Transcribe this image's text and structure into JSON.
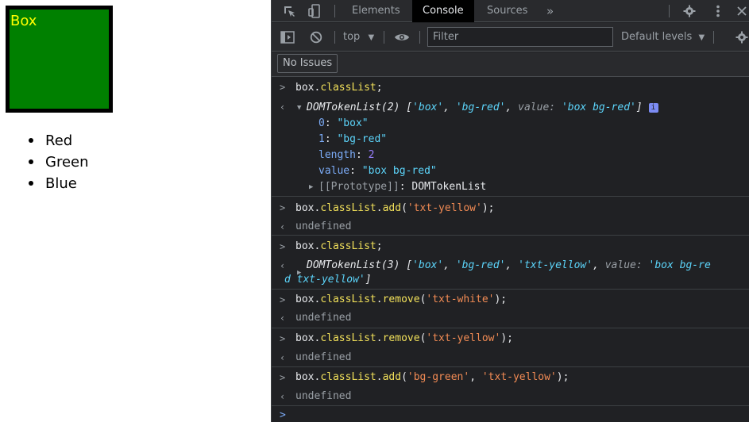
{
  "page": {
    "box_text": "Box",
    "list_items": [
      "Red",
      "Green",
      "Blue"
    ],
    "colors": {
      "box_bg": "#008000",
      "box_text": "#ffff00",
      "box_border": "#000000"
    }
  },
  "devtools": {
    "tabs": [
      "Elements",
      "Console",
      "Sources"
    ],
    "active_tab": "Console",
    "more_tabs_glyph": "»",
    "context": "top",
    "filter_placeholder": "Filter",
    "levels": "Default levels",
    "issues_button": "No Issues",
    "icons": [
      "inspect-icon",
      "device-toggle-icon",
      "gear-icon",
      "more-vert-icon",
      "sidebar-toggle-icon",
      "clear-console-icon",
      "eye-icon",
      "settings-icon"
    ]
  },
  "console": {
    "cmd1": {
      "obj": "box",
      "prop": "classList",
      "end": ";"
    },
    "out1": {
      "type": "DOMTokenList(2)",
      "summary_open": "[",
      "s1": "'box'",
      "s2": "'bg-red'",
      "value_key": "value:",
      "value_str": "'box bg-red'",
      "summary_close": "]",
      "badge": "i",
      "props": [
        {
          "key": "0",
          "val": "\"box\""
        },
        {
          "key": "1",
          "val": "\"bg-red\""
        },
        {
          "key": "length",
          "val": "2"
        },
        {
          "key": "value",
          "val": "\"box bg-red\""
        }
      ],
      "proto_key": "[[Prototype]]",
      "proto_val": "DOMTokenList"
    },
    "cmd2": {
      "obj": "box",
      "prop": "classList",
      "method": "add",
      "args": "'txt-yellow'"
    },
    "out2": "undefined",
    "cmd3": {
      "obj": "box",
      "prop": "classList",
      "end": ";"
    },
    "out3": {
      "type": "DOMTokenList(3)",
      "s1": "'box'",
      "s2": "'bg-red'",
      "s3": "'txt-yellow'",
      "value_key": "value:",
      "value_str_a": "'box bg-re",
      "value_str_b": "d txt-yellow'"
    },
    "cmd4": {
      "obj": "box",
      "prop": "classList",
      "method": "remove",
      "args": "'txt-white'"
    },
    "out4": "undefined",
    "cmd5": {
      "obj": "box",
      "prop": "classList",
      "method": "remove",
      "args": "'txt-yellow'"
    },
    "out5": "undefined",
    "cmd6": {
      "obj": "box",
      "prop": "classList",
      "method": "add",
      "args1": "'bg-green'",
      "args2": "'txt-yellow'"
    },
    "out6": "undefined"
  }
}
